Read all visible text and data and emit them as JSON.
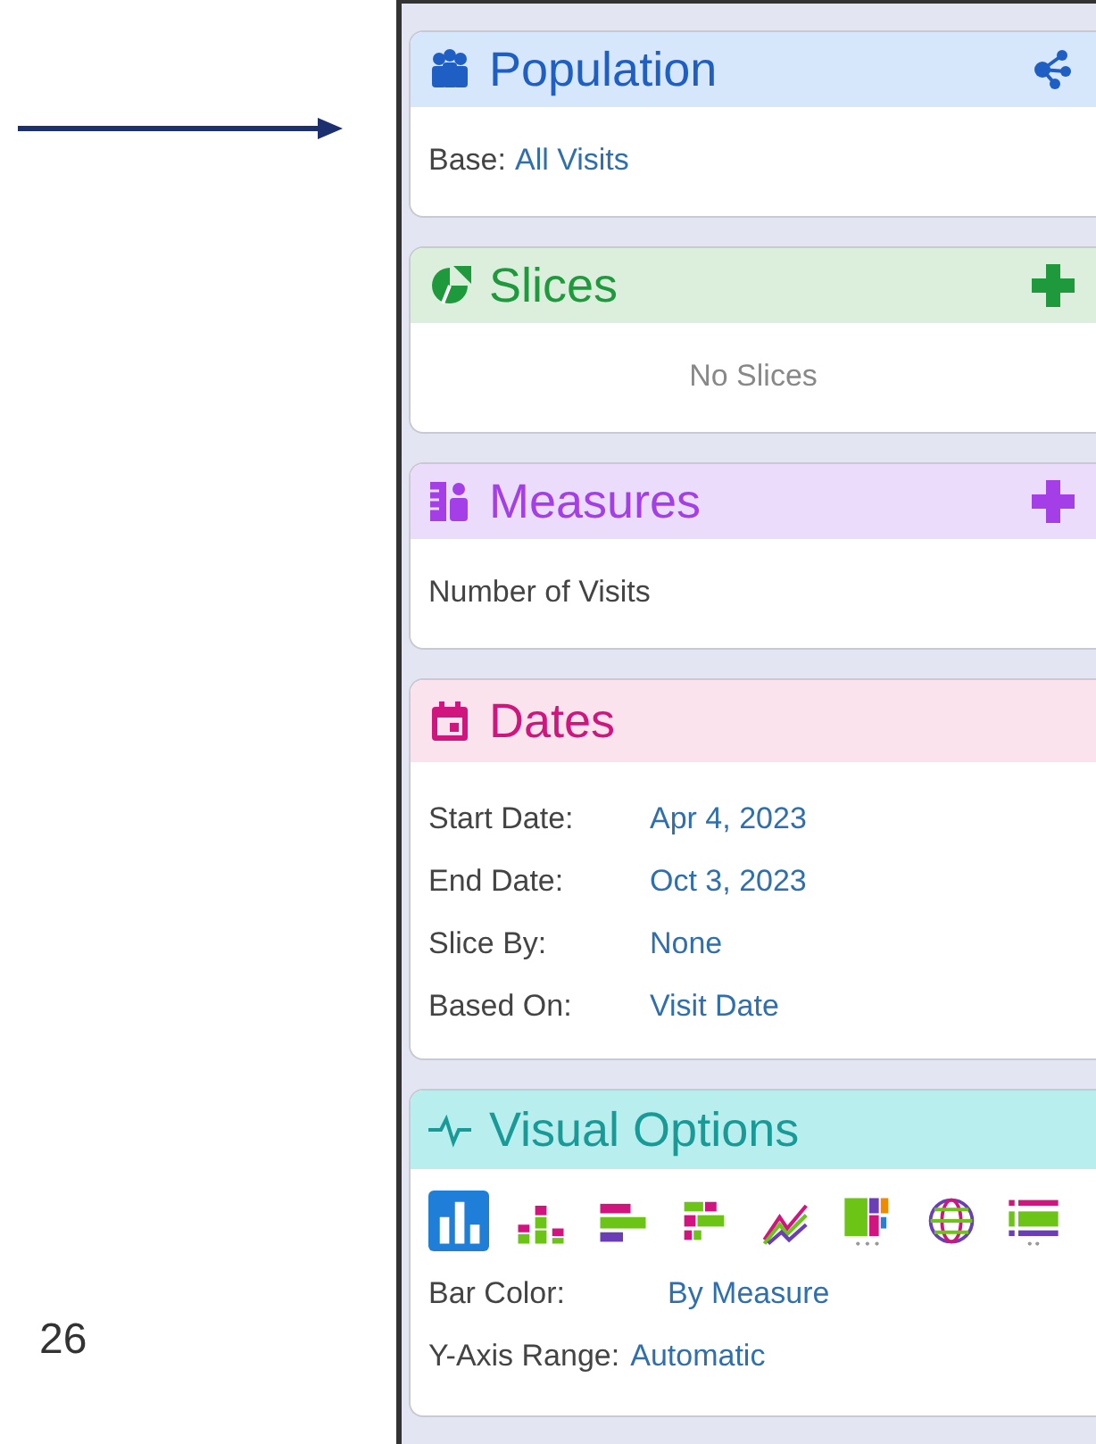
{
  "slide": {
    "page_number": "26"
  },
  "panels": [
    {
      "kind": "population",
      "title": "Population",
      "action": {
        "kind": "network"
      },
      "rows": [
        {
          "kind": "inline",
          "label": "Base:",
          "value": "All Visits"
        }
      ]
    },
    {
      "kind": "slices",
      "title": "Slices",
      "action": {
        "kind": "add"
      },
      "rows": [
        {
          "kind": "empty",
          "text": "No Slices"
        }
      ]
    },
    {
      "kind": "measures",
      "title": "Measures",
      "action": {
        "kind": "add"
      },
      "rows": [
        {
          "kind": "plain",
          "text": "Number of Visits"
        }
      ]
    },
    {
      "kind": "dates",
      "title": "Dates",
      "rows": [
        {
          "kind": "pair",
          "label": "Start Date:",
          "value": "Apr 4, 2023"
        },
        {
          "kind": "pair",
          "label": "End Date:",
          "value": "Oct 3, 2023"
        },
        {
          "kind": "pair",
          "label": "Slice By:",
          "value": "None"
        },
        {
          "kind": "pair",
          "label": "Based On:",
          "value": "Visit Date"
        }
      ]
    },
    {
      "kind": "visual",
      "title": "Visual Options",
      "chart_types": [
        {
          "kind": "bar",
          "selected": true
        },
        {
          "kind": "stacked",
          "selected": false
        },
        {
          "kind": "hbar",
          "selected": false
        },
        {
          "kind": "hstacked",
          "selected": false
        },
        {
          "kind": "line",
          "selected": false
        },
        {
          "kind": "treemap",
          "selected": false
        },
        {
          "kind": "globe",
          "selected": false
        },
        {
          "kind": "table",
          "selected": false
        }
      ],
      "rows": [
        {
          "kind": "pair2",
          "label": "Bar Color:",
          "value": "By Measure"
        },
        {
          "kind": "pair2",
          "label": "Y-Axis Range:",
          "value": "Automatic"
        }
      ]
    }
  ]
}
